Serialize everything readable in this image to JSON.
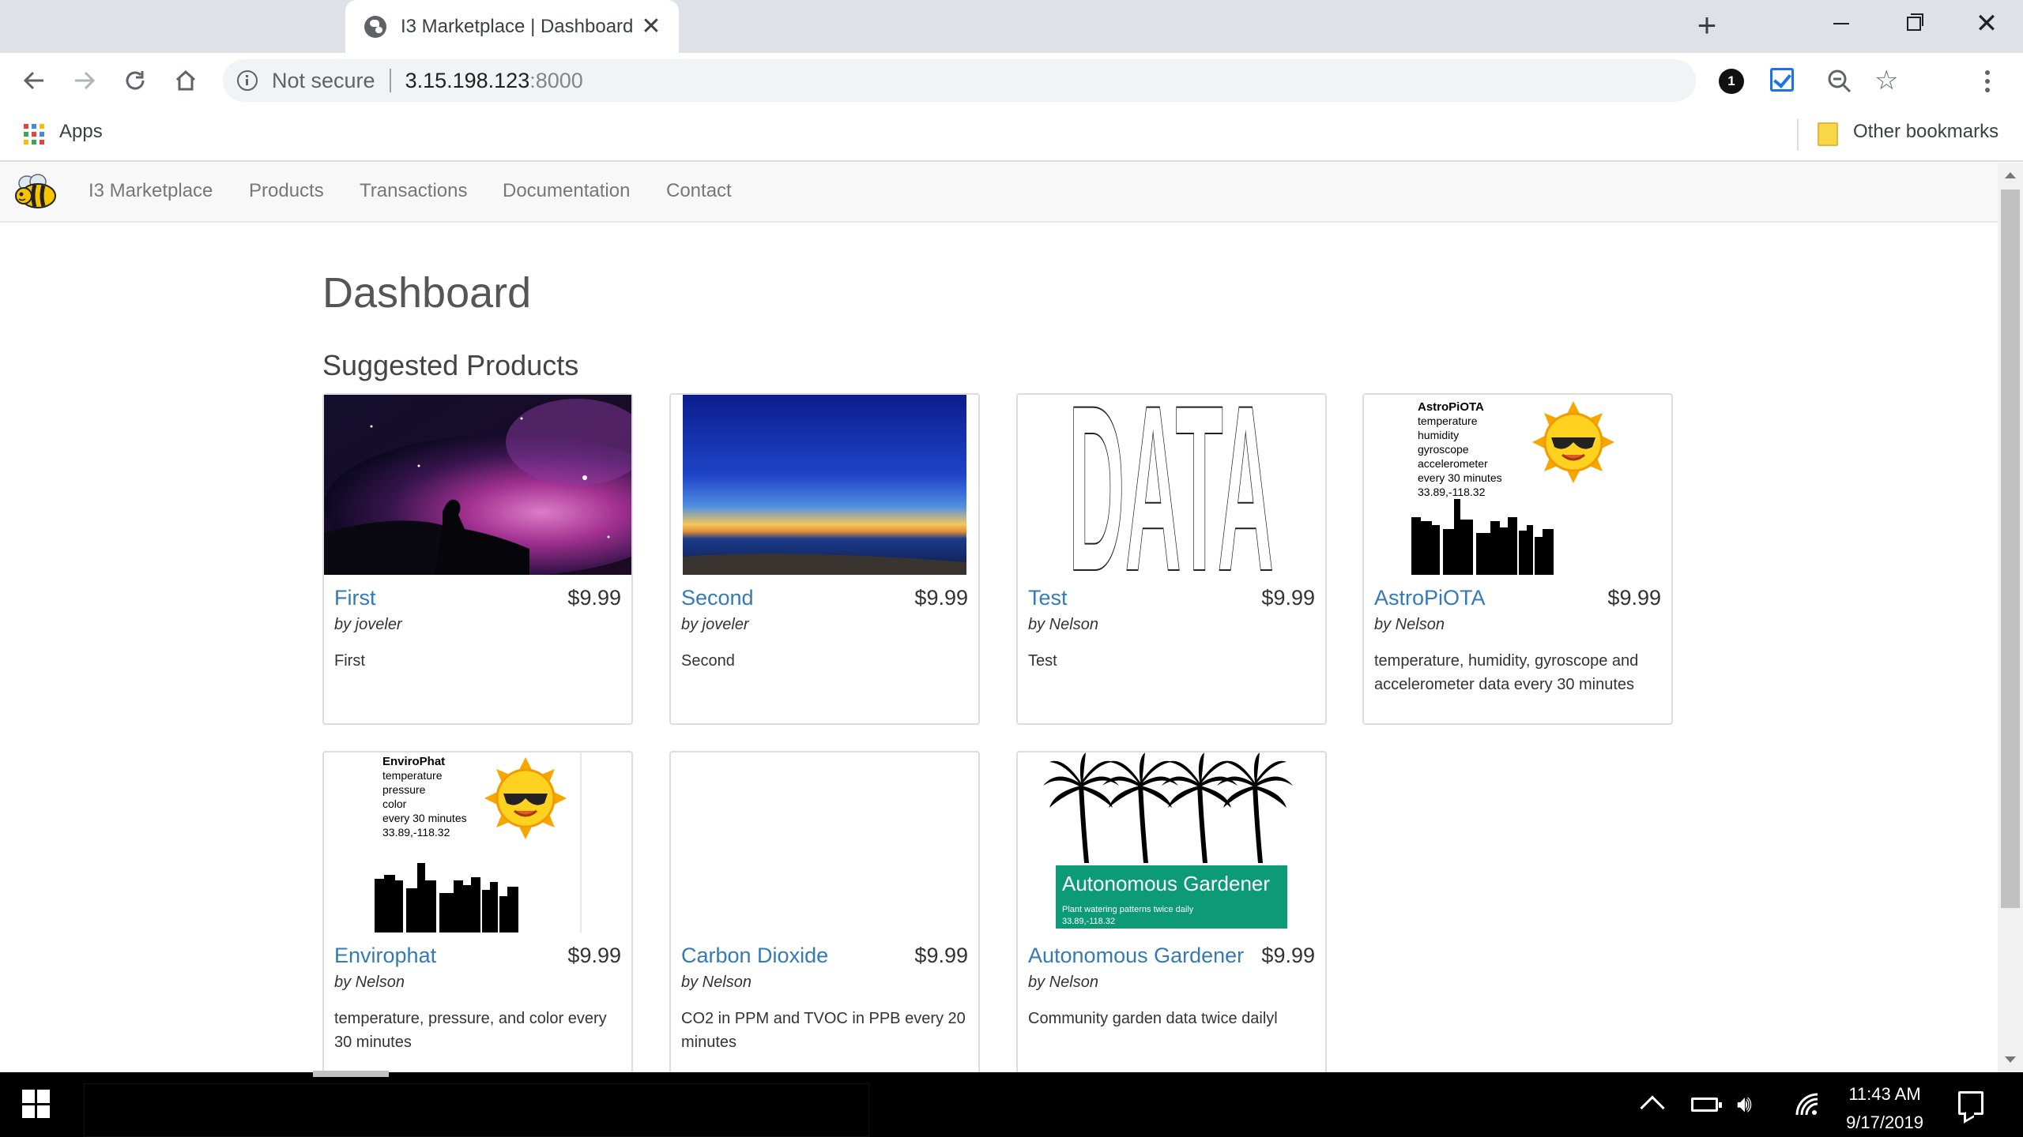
{
  "browser": {
    "tab_title": "I3 Marketplace | Dashboard",
    "tab_close": "✕",
    "new_tab": "+",
    "not_secure": "Not secure",
    "url_host": "3.15.198.123",
    "url_port": ":8000",
    "extension_badge": "1",
    "bookmarks": {
      "apps": "Apps",
      "other": "Other bookmarks"
    }
  },
  "navbar": {
    "brand": "I3 Marketplace",
    "links": [
      "Products",
      "Transactions",
      "Documentation",
      "Contact"
    ]
  },
  "page": {
    "title": "Dashboard",
    "section": "Suggested Products"
  },
  "products": [
    {
      "title": "First",
      "price": "$9.99",
      "author": "by joveler",
      "description": "First",
      "image": "nebula"
    },
    {
      "title": "Second",
      "price": "$9.99",
      "author": "by joveler",
      "description": "Second",
      "image": "sunset-sea"
    },
    {
      "title": "Test",
      "price": "$9.99",
      "author": "by Nelson",
      "description": "Test",
      "image": "data-text"
    },
    {
      "title": "AstroPiOTA",
      "price": "$9.99",
      "author": "by Nelson",
      "description": "temperature, humidity, gyroscope and accelerometer data every 30 minutes",
      "image": "sun-skyline",
      "image_text": {
        "name": "AstroPiOTA",
        "lines": [
          "temperature",
          "humidity",
          "gyroscope",
          "accelerometer",
          "every 30 minutes",
          "33.89,-118.32"
        ]
      }
    },
    {
      "title": "Envirophat",
      "price": "$9.99",
      "author": "by Nelson",
      "description": "temperature, pressure, and color every 30 minutes",
      "image": "sun-skyline",
      "image_text": {
        "name": "EnviroPhat",
        "lines": [
          "temperature",
          "pressure",
          "color",
          "every 30 minutes",
          "33.89,-118.32"
        ]
      }
    },
    {
      "title": "Carbon Dioxide",
      "price": "$9.99",
      "author": "by Nelson",
      "description": "CO2 in PPM and TVOC in PPB every 20 minutes",
      "image": "blank"
    },
    {
      "title": "Autonomous Gardener",
      "price": "$9.99",
      "author": "by Nelson",
      "description": "Community garden data twice dailyl",
      "image": "palms",
      "image_text": {
        "banner": "Autonomous Gardener",
        "sub1": "Plant watering patterns twice daily",
        "sub2": "33.89,-118.32"
      }
    }
  ],
  "taskbar": {
    "time": "11:43 AM",
    "date": "9/17/2019"
  },
  "colors": {
    "link": "#337ab7",
    "navbar_bg": "#f8f8f8",
    "banner_green": "#0c9a77"
  }
}
